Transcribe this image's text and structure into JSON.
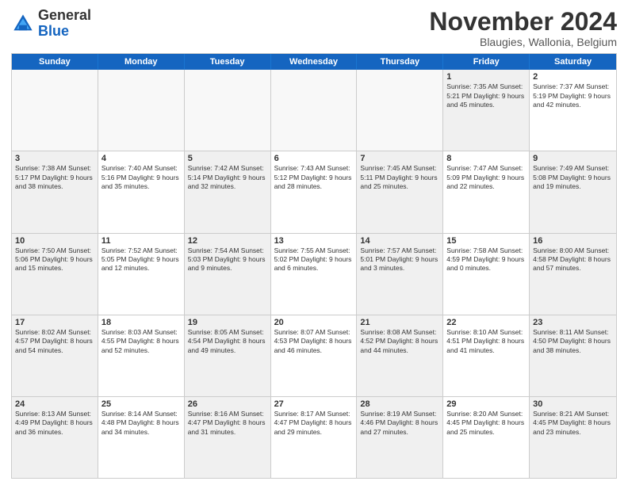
{
  "logo": {
    "text_general": "General",
    "text_blue": "Blue"
  },
  "title": "November 2024",
  "location": "Blaugies, Wallonia, Belgium",
  "header_days": [
    "Sunday",
    "Monday",
    "Tuesday",
    "Wednesday",
    "Thursday",
    "Friday",
    "Saturday"
  ],
  "weeks": [
    [
      {
        "day": "",
        "info": "",
        "empty": true
      },
      {
        "day": "",
        "info": "",
        "empty": true
      },
      {
        "day": "",
        "info": "",
        "empty": true
      },
      {
        "day": "",
        "info": "",
        "empty": true
      },
      {
        "day": "",
        "info": "",
        "empty": true
      },
      {
        "day": "1",
        "info": "Sunrise: 7:35 AM\nSunset: 5:21 PM\nDaylight: 9 hours and 45 minutes.",
        "empty": false,
        "shaded": true
      },
      {
        "day": "2",
        "info": "Sunrise: 7:37 AM\nSunset: 5:19 PM\nDaylight: 9 hours and 42 minutes.",
        "empty": false,
        "shaded": false
      }
    ],
    [
      {
        "day": "3",
        "info": "Sunrise: 7:38 AM\nSunset: 5:17 PM\nDaylight: 9 hours and 38 minutes.",
        "empty": false,
        "shaded": true
      },
      {
        "day": "4",
        "info": "Sunrise: 7:40 AM\nSunset: 5:16 PM\nDaylight: 9 hours and 35 minutes.",
        "empty": false,
        "shaded": false
      },
      {
        "day": "5",
        "info": "Sunrise: 7:42 AM\nSunset: 5:14 PM\nDaylight: 9 hours and 32 minutes.",
        "empty": false,
        "shaded": true
      },
      {
        "day": "6",
        "info": "Sunrise: 7:43 AM\nSunset: 5:12 PM\nDaylight: 9 hours and 28 minutes.",
        "empty": false,
        "shaded": false
      },
      {
        "day": "7",
        "info": "Sunrise: 7:45 AM\nSunset: 5:11 PM\nDaylight: 9 hours and 25 minutes.",
        "empty": false,
        "shaded": true
      },
      {
        "day": "8",
        "info": "Sunrise: 7:47 AM\nSunset: 5:09 PM\nDaylight: 9 hours and 22 minutes.",
        "empty": false,
        "shaded": false
      },
      {
        "day": "9",
        "info": "Sunrise: 7:49 AM\nSunset: 5:08 PM\nDaylight: 9 hours and 19 minutes.",
        "empty": false,
        "shaded": true
      }
    ],
    [
      {
        "day": "10",
        "info": "Sunrise: 7:50 AM\nSunset: 5:06 PM\nDaylight: 9 hours and 15 minutes.",
        "empty": false,
        "shaded": true
      },
      {
        "day": "11",
        "info": "Sunrise: 7:52 AM\nSunset: 5:05 PM\nDaylight: 9 hours and 12 minutes.",
        "empty": false,
        "shaded": false
      },
      {
        "day": "12",
        "info": "Sunrise: 7:54 AM\nSunset: 5:03 PM\nDaylight: 9 hours and 9 minutes.",
        "empty": false,
        "shaded": true
      },
      {
        "day": "13",
        "info": "Sunrise: 7:55 AM\nSunset: 5:02 PM\nDaylight: 9 hours and 6 minutes.",
        "empty": false,
        "shaded": false
      },
      {
        "day": "14",
        "info": "Sunrise: 7:57 AM\nSunset: 5:01 PM\nDaylight: 9 hours and 3 minutes.",
        "empty": false,
        "shaded": true
      },
      {
        "day": "15",
        "info": "Sunrise: 7:58 AM\nSunset: 4:59 PM\nDaylight: 9 hours and 0 minutes.",
        "empty": false,
        "shaded": false
      },
      {
        "day": "16",
        "info": "Sunrise: 8:00 AM\nSunset: 4:58 PM\nDaylight: 8 hours and 57 minutes.",
        "empty": false,
        "shaded": true
      }
    ],
    [
      {
        "day": "17",
        "info": "Sunrise: 8:02 AM\nSunset: 4:57 PM\nDaylight: 8 hours and 54 minutes.",
        "empty": false,
        "shaded": true
      },
      {
        "day": "18",
        "info": "Sunrise: 8:03 AM\nSunset: 4:55 PM\nDaylight: 8 hours and 52 minutes.",
        "empty": false,
        "shaded": false
      },
      {
        "day": "19",
        "info": "Sunrise: 8:05 AM\nSunset: 4:54 PM\nDaylight: 8 hours and 49 minutes.",
        "empty": false,
        "shaded": true
      },
      {
        "day": "20",
        "info": "Sunrise: 8:07 AM\nSunset: 4:53 PM\nDaylight: 8 hours and 46 minutes.",
        "empty": false,
        "shaded": false
      },
      {
        "day": "21",
        "info": "Sunrise: 8:08 AM\nSunset: 4:52 PM\nDaylight: 8 hours and 44 minutes.",
        "empty": false,
        "shaded": true
      },
      {
        "day": "22",
        "info": "Sunrise: 8:10 AM\nSunset: 4:51 PM\nDaylight: 8 hours and 41 minutes.",
        "empty": false,
        "shaded": false
      },
      {
        "day": "23",
        "info": "Sunrise: 8:11 AM\nSunset: 4:50 PM\nDaylight: 8 hours and 38 minutes.",
        "empty": false,
        "shaded": true
      }
    ],
    [
      {
        "day": "24",
        "info": "Sunrise: 8:13 AM\nSunset: 4:49 PM\nDaylight: 8 hours and 36 minutes.",
        "empty": false,
        "shaded": true
      },
      {
        "day": "25",
        "info": "Sunrise: 8:14 AM\nSunset: 4:48 PM\nDaylight: 8 hours and 34 minutes.",
        "empty": false,
        "shaded": false
      },
      {
        "day": "26",
        "info": "Sunrise: 8:16 AM\nSunset: 4:47 PM\nDaylight: 8 hours and 31 minutes.",
        "empty": false,
        "shaded": true
      },
      {
        "day": "27",
        "info": "Sunrise: 8:17 AM\nSunset: 4:47 PM\nDaylight: 8 hours and 29 minutes.",
        "empty": false,
        "shaded": false
      },
      {
        "day": "28",
        "info": "Sunrise: 8:19 AM\nSunset: 4:46 PM\nDaylight: 8 hours and 27 minutes.",
        "empty": false,
        "shaded": true
      },
      {
        "day": "29",
        "info": "Sunrise: 8:20 AM\nSunset: 4:45 PM\nDaylight: 8 hours and 25 minutes.",
        "empty": false,
        "shaded": false
      },
      {
        "day": "30",
        "info": "Sunrise: 8:21 AM\nSunset: 4:45 PM\nDaylight: 8 hours and 23 minutes.",
        "empty": false,
        "shaded": true
      }
    ]
  ]
}
